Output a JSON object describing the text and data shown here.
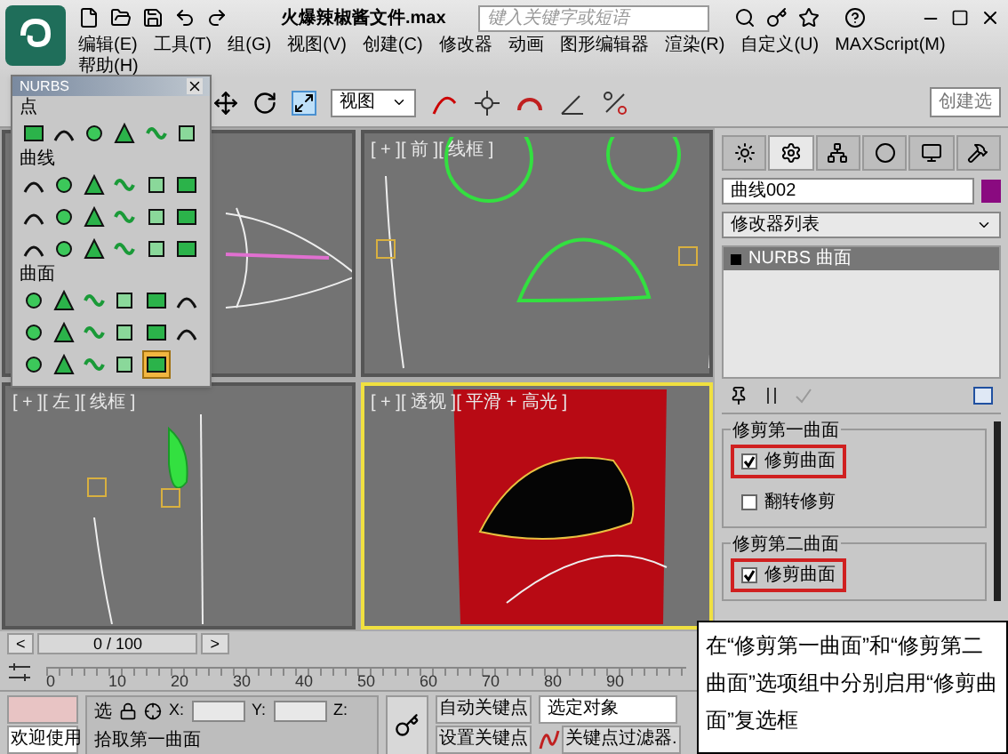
{
  "app": {
    "title": "火爆辣椒酱文件.max",
    "search": {
      "placeholder": "键入关键字或短语"
    }
  },
  "menu": [
    "编辑(E)",
    "工具(T)",
    "组(G)",
    "视图(V)",
    "创建(C)",
    "修改器",
    "动画",
    "图形编辑器",
    "渲染(R)",
    "自定义(U)",
    "MAXScript(M)",
    "帮助(H)"
  ],
  "toolbar": {
    "view_dropdown": "视图",
    "selection_set": "创建选"
  },
  "nurbs_panel": {
    "title": "NURBS",
    "sections": [
      {
        "label": "点",
        "tools": [
          {
            "selected": false
          },
          {
            "selected": false
          },
          {
            "selected": false
          },
          {
            "selected": false
          },
          {
            "selected": false
          },
          {
            "selected": false
          }
        ]
      },
      {
        "label": "曲线",
        "tools": [
          {
            "selected": false
          },
          {
            "selected": false
          },
          {
            "selected": false
          },
          {
            "selected": false
          },
          {
            "selected": false
          },
          {
            "selected": false
          },
          {
            "selected": false
          },
          {
            "selected": false
          },
          {
            "selected": false
          },
          {
            "selected": false
          },
          {
            "selected": false
          },
          {
            "selected": false
          },
          {
            "selected": false
          },
          {
            "selected": false
          },
          {
            "selected": false
          },
          {
            "selected": false
          },
          {
            "selected": false
          },
          {
            "selected": false
          }
        ]
      },
      {
        "label": "曲面",
        "tools": [
          {
            "selected": false
          },
          {
            "selected": false
          },
          {
            "selected": false
          },
          {
            "selected": false
          },
          {
            "selected": false
          },
          {
            "selected": false
          },
          {
            "selected": false
          },
          {
            "selected": false
          },
          {
            "selected": false
          },
          {
            "selected": false
          },
          {
            "selected": false
          },
          {
            "selected": false
          },
          {
            "selected": false
          },
          {
            "selected": false
          },
          {
            "selected": false
          },
          {
            "selected": false
          },
          {
            "selected": true
          }
        ]
      }
    ]
  },
  "viewports": [
    {
      "kind": "top",
      "active": false
    },
    {
      "kind": "front",
      "label": "[ + ][ 前 ][ 线框 ]",
      "active": false
    },
    {
      "kind": "left",
      "label": "[ + ][ 左 ][ 线框 ]",
      "active": false
    },
    {
      "kind": "perspective",
      "label": "[ + ][ 透视 ][ 平滑 + 高光 ]",
      "active": true
    }
  ],
  "command_panel": {
    "tabs": [
      {
        "selected": false
      },
      {
        "selected": true
      },
      {
        "selected": false
      },
      {
        "selected": false
      },
      {
        "selected": false
      },
      {
        "selected": false
      }
    ],
    "name_field": {
      "value": "曲线002",
      "color": "#8a0a80"
    },
    "modifier_list": "修改器列表",
    "stack": [
      {
        "label": "NURBS 曲面",
        "selected": true
      }
    ],
    "rollouts": [
      {
        "title": "修剪第一曲面",
        "options": [
          {
            "label": "修剪曲面",
            "checked": true,
            "highlighted": true
          },
          {
            "label": "翻转修剪",
            "checked": false,
            "highlighted": false
          }
        ]
      },
      {
        "title": "修剪第二曲面",
        "options": [
          {
            "label": "修剪曲面",
            "checked": true,
            "highlighted": true
          }
        ]
      }
    ]
  },
  "timeline": {
    "slider": "0 / 100",
    "prev": "<",
    "next": ">",
    "ticks": [
      "0",
      "10",
      "20",
      "30",
      "40",
      "50",
      "60",
      "70",
      "80",
      "90"
    ]
  },
  "status_bar": {
    "welcome": "欢迎使用",
    "select_label": "选",
    "x_label": "X:",
    "y_label": "Y:",
    "z_label": "Z:",
    "prompt": "拾取第一曲面",
    "auto_key": "自动关键点",
    "set_key": "设置关键点",
    "selection_dropdown": "选定对象",
    "key_filters": "关键点过滤器."
  },
  "callout": {
    "text": "在“修剪第一曲面”和“修剪第二曲面”选项组中分别启用“修剪曲面”复选框"
  }
}
